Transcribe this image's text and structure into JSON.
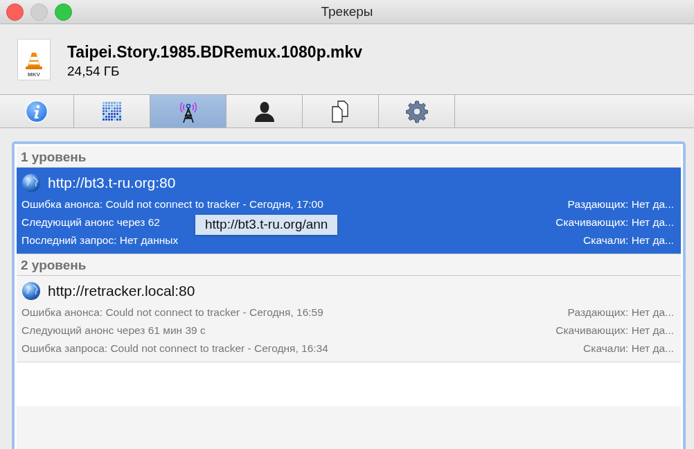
{
  "window": {
    "title": "Трекеры"
  },
  "file": {
    "name": "Taipei.Story.1985.BDRemux.1080p.mkv",
    "size": "24,54 ГБ",
    "badge": "MKV"
  },
  "tabs": [
    {
      "kind": "info",
      "selected": false
    },
    {
      "kind": "pieces",
      "selected": false
    },
    {
      "kind": "trackers",
      "selected": true
    },
    {
      "kind": "peers",
      "selected": false
    },
    {
      "kind": "files",
      "selected": false
    },
    {
      "kind": "options",
      "selected": false
    }
  ],
  "groups": [
    {
      "title": "1 уровень",
      "trackers": [
        {
          "url": "http://bt3.t-ru.org:80",
          "selected": true,
          "lines": [
            {
              "left": "Ошибка анонса: Could not connect to tracker - Сегодня, 17:00",
              "right": "Раздающих: Нет да..."
            },
            {
              "left": "Следующий анонс через 62",
              "right": "Скачивающих: Нет да..."
            },
            {
              "left": "Последний запрос: Нет данных",
              "right": "Скачали: Нет да..."
            }
          ]
        }
      ]
    },
    {
      "title": "2 уровень",
      "trackers": [
        {
          "url": "http://retracker.local:80",
          "selected": false,
          "lines": [
            {
              "left": "Ошибка анонса: Could not connect to tracker - Сегодня, 16:59",
              "right": "Раздающих: Нет да..."
            },
            {
              "left": "Следующий анонс через 61 мин 39 с",
              "right": "Скачивающих: Нет да..."
            },
            {
              "left": "Ошибка запроса: Could not connect to tracker - Сегодня, 16:34",
              "right": "Скачали: Нет да..."
            }
          ]
        }
      ]
    }
  ],
  "tooltip": {
    "text": "http://bt3.t-ru.org/ann"
  }
}
